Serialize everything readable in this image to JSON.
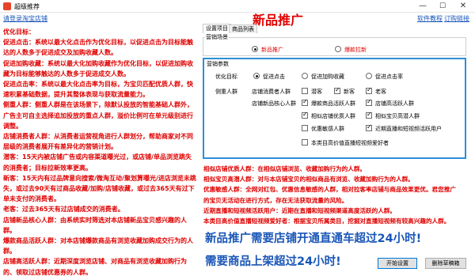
{
  "window": {
    "title": "超级推荐",
    "minimize_glyph": "—",
    "maximize_glyph": "☐",
    "close_glyph": "✕"
  },
  "links": {
    "login": "请登录淘宝店铺",
    "software_tutorial": "软件教程",
    "subscribe": "订购链接"
  },
  "left_panel": {
    "paragraphs": [
      "优化目标：",
      "促进点击：系统以最大化点击作为优化目标，以促进点击为目标能触达的人数多于促进成交及加购收藏人数。",
      "促进加购收藏：系统以最大化加购收藏作为优化目标，以促进加购收藏为目标能够触达的人数多于促进成交人数。",
      "促进点击率：系统以最大化点击率为目标，为宝贝匹配优质人群，快速积累基础数据，提升其整体表现与获取流量能力。",
      "侧重人群：侧重人群是在该场景下，除默认投放的智能基础人群外，广告主可自主选择追加投放的重点人群，溢价比例可在单元级别进行调整。",
      "店铺消费者人群：从消费者运营视角进行人群划分，帮助商家对不同层级的消费者展开有差异化的营销计划。",
      "潜客：15天内被店铺广告或内容渠道曝光过，或店铺/单品浏览跳失的消费者；目标拉新效率更高。",
      "新客：15天内有过品牌意向搜索/微淘互动/聚划算曝光/进店浏览未跳失，或过去90天有过商品收藏/加购/店铺收藏，或过去365天有过下单未支付的消费者。",
      "老客：过去365天有过店铺成交的消费者。",
      "店铺新品核心人群：由系统实时筛选对本店铺新品宝贝感兴趣的人群。",
      "爆款商品活跃人群：对本店铺爆款商品有浏览收藏加购成交行为的人群。",
      "店铺高活跃人群：近期深度浏览店铺、对商品有浏览收藏加购行为的、领取过店铺优惠券的人群。"
    ]
  },
  "main": {
    "heading": "新品推广",
    "tabs": [
      {
        "label": "设置项目"
      },
      {
        "label": "商品列表"
      }
    ],
    "scene": {
      "group_label": "营销场景",
      "options": [
        {
          "label": "新品推广",
          "selected": true
        },
        {
          "label": "爆款拉新",
          "selected": false
        }
      ]
    },
    "params": {
      "group_label": "营销参数",
      "goal_label": "优化目标",
      "goal_options": [
        {
          "label": "促进点击",
          "selected": true
        },
        {
          "label": "促进加购收藏",
          "selected": false
        },
        {
          "label": "促进点击率",
          "selected": false
        }
      ],
      "crowd_label": "侧重人群",
      "consumer_label": "店铺消费者人群",
      "consumer_options": [
        {
          "label": "潜客",
          "checked": false
        },
        {
          "label": "新客",
          "checked": true
        },
        {
          "label": "老客",
          "checked": true
        }
      ],
      "core_label": "店铺新品核心人群",
      "core_options": [
        {
          "label": "爆款商品活跃人群",
          "checked": true
        },
        {
          "label": "店铺高活跃人群",
          "checked": true
        },
        {
          "label": "相似店铺优质人群",
          "checked": true
        },
        {
          "label": "相似宝贝高潜人群",
          "checked": true
        },
        {
          "label": "优惠敏感人群",
          "checked": false
        },
        {
          "label": "近期直播和短视频活跃用户",
          "checked": true
        },
        {
          "label": "本类目高价值直播短视频爱好者",
          "checked": false
        }
      ]
    },
    "right_notes": [
      "相似店铺优质人群：在相似店铺浏览、收藏加购行为的人群。",
      "相似宝贝高潜人群：对与本店铺宝贝的相似商品有浏览、收藏加购行为的人群。",
      "优惠敏感人群：全网对红包、优惠信息敏感的人群，相对拉客率店铺与商品效果更优。君您推广",
      "的宝贝无活动在进行方式，存在无法获取流量的风险。",
      "近期直播和短视频活跃用户：近期在直播和短视频渠道高度活跃的人群。",
      "本类目高价值直播短视频爱好者：根据宝贝所属类目，挖掘对直播短视频有较高兴趣的人群。"
    ],
    "big_notes": [
      "新品推广需要店铺开通直通车超过24小时!",
      "需要商品上架超过24小时!"
    ],
    "buttons": {
      "start": "开始设置",
      "delete_draft": "删除草稿箱"
    }
  }
}
